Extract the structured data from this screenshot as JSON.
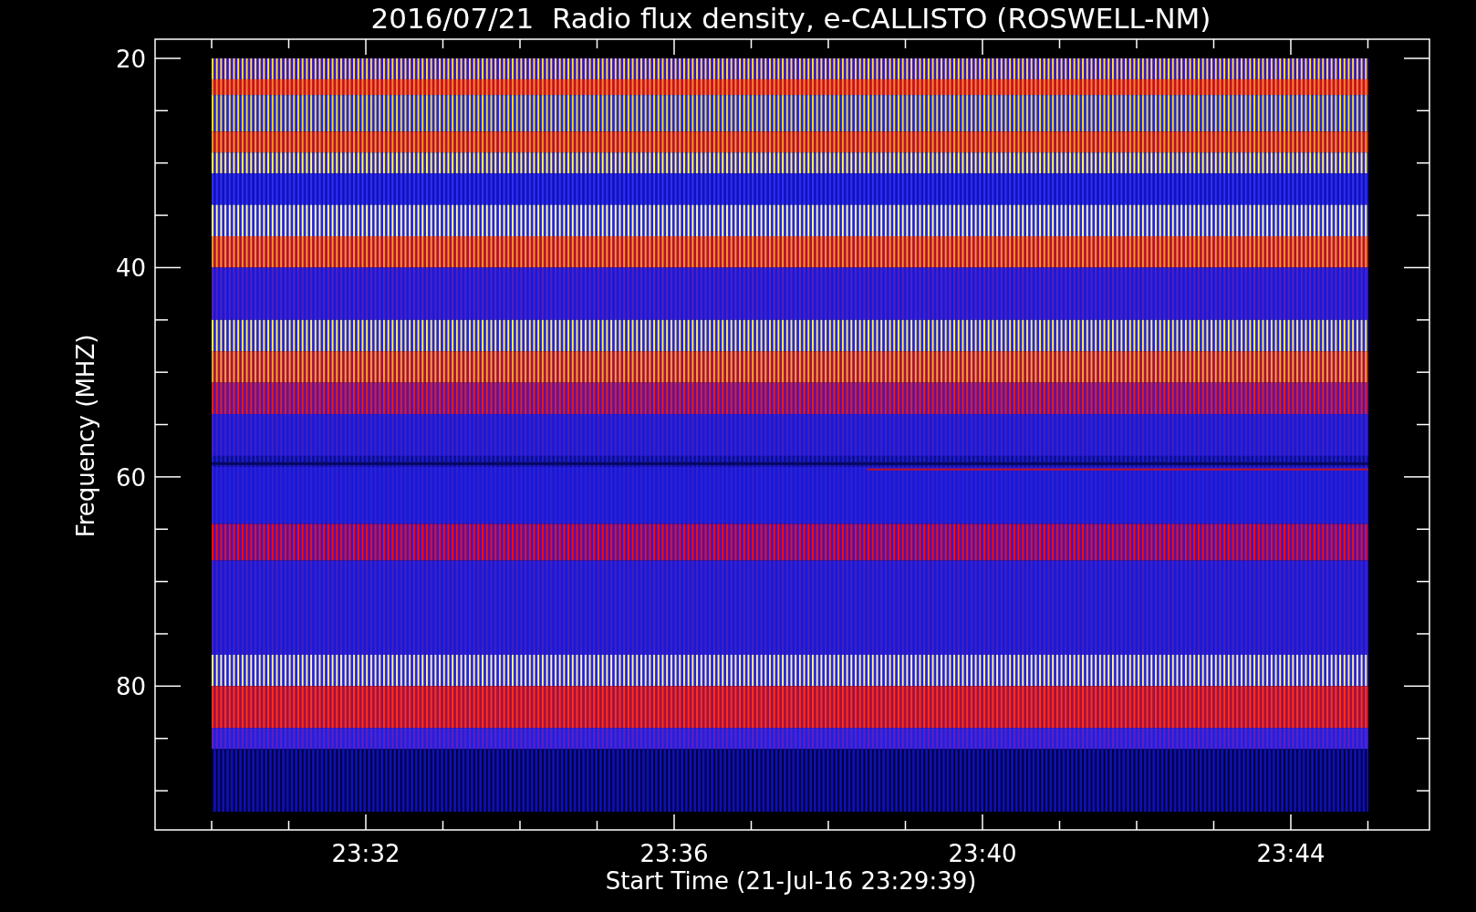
{
  "plot": {
    "title": "2016/07/21  Radio flux density, e-CALLISTO (ROSWELL-NM)",
    "ylabel": "Frequency (MHZ)",
    "xlabel": "Start Time (21-Jul-16 23:29:39)",
    "yticks": [
      "20",
      "40",
      "60",
      "80"
    ],
    "xticks": [
      "23:32",
      "23:36",
      "23:40",
      "23:44"
    ]
  }
}
